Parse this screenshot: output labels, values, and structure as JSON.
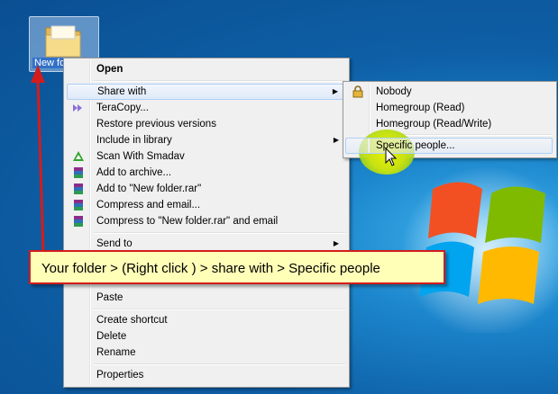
{
  "desktop": {
    "folder_label": "New folder"
  },
  "context_menu": {
    "items": [
      {
        "label": "Open",
        "bold": true
      },
      {
        "label": "Share with",
        "submenu": true
      },
      {
        "label": "TeraCopy..."
      },
      {
        "label": "Restore previous versions"
      },
      {
        "label": "Include in library",
        "submenu": true
      },
      {
        "label": "Scan With Smadav"
      },
      {
        "label": "Add to archive..."
      },
      {
        "label": "Add to \"New folder.rar\""
      },
      {
        "label": "Compress and email..."
      },
      {
        "label": "Compress to \"New folder.rar\" and email"
      },
      {
        "label": "Send to",
        "submenu": true
      },
      {
        "label": "Paste"
      },
      {
        "label": "Create shortcut"
      },
      {
        "label": "Delete"
      },
      {
        "label": "Rename"
      },
      {
        "label": "Properties"
      }
    ]
  },
  "share_submenu": {
    "items": [
      {
        "label": "Nobody"
      },
      {
        "label": "Homegroup (Read)"
      },
      {
        "label": "Homegroup (Read/Write)"
      },
      {
        "label": "Specific people..."
      }
    ]
  },
  "callout": {
    "text": "Your folder > (Right click ) > share with > Specific people"
  },
  "colors": {
    "callout_border": "#d21c1c",
    "callout_bg": "#ffffb8",
    "menu_bg": "#f0f0f0",
    "highlight": "#dfe9f8"
  },
  "icons": {
    "teracopy": "teracopy-icon",
    "smadav": "smadav-icon",
    "winrar": "winrar-icon",
    "lock": "lock-icon",
    "folder": "folder-icon"
  }
}
